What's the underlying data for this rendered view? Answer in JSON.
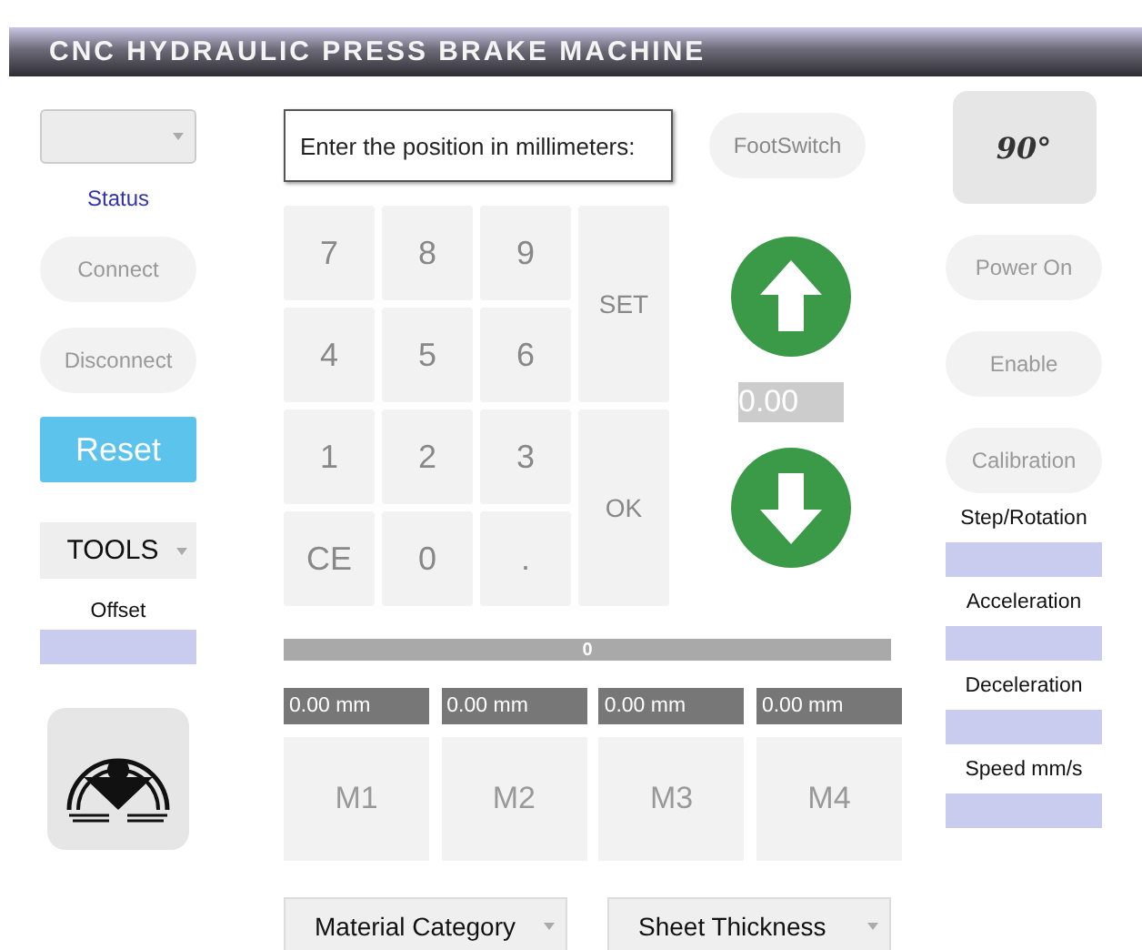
{
  "window": {
    "title": "CNC HYDRAULIC PRESS BRAKE MACHINE"
  },
  "left": {
    "status": "Status",
    "buttons": [
      {
        "label": "Connect",
        "kind": "plain"
      },
      {
        "label": "Disconnect",
        "kind": "plain"
      },
      {
        "label": "Reset",
        "kind": "primary"
      }
    ],
    "tools": "TOOLS",
    "offset": {
      "label": "Offset"
    }
  },
  "position_input": {
    "placeholder": "Enter the position in millimeters:"
  },
  "footswitch": "FootSwitch",
  "keypad": {
    "keys": [
      "7",
      "8",
      "9",
      "4",
      "5",
      "6",
      "1",
      "2",
      "3",
      "CE",
      "0",
      "."
    ],
    "actions": [
      "SET",
      "OK"
    ]
  },
  "jog": {
    "speed": "0.00"
  },
  "progress": {
    "level": 0,
    "reading": "0"
  },
  "memories": [
    {
      "label": "M1",
      "reading": "0.00 mm"
    },
    {
      "label": "M2",
      "reading": "0.00 mm"
    },
    {
      "label": "M3",
      "reading": "0.00 mm"
    },
    {
      "label": "M4",
      "reading": "0.00 mm"
    }
  ],
  "selects": [
    "Material Category",
    "Sheet Thickness"
  ],
  "right": {
    "angle": "90°",
    "buttons": [
      "Power On",
      "Enable",
      "Calibration"
    ],
    "fields": [
      {
        "label": "Step/Rotation"
      },
      {
        "label": "Acceleration"
      },
      {
        "label": "Deceleration"
      },
      {
        "label": "Speed mm/s"
      }
    ]
  }
}
